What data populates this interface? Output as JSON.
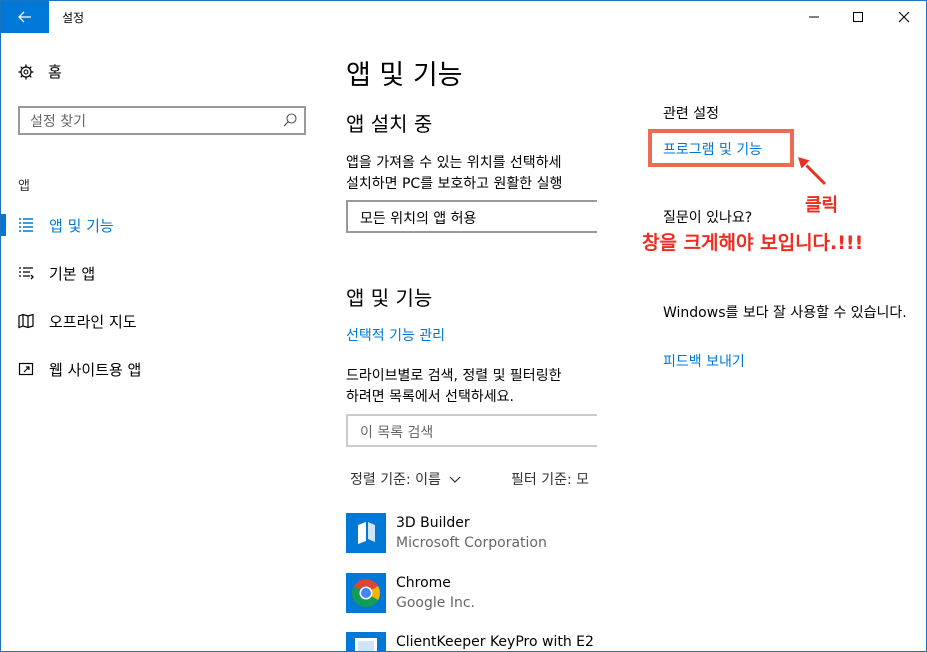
{
  "window": {
    "title": "설정"
  },
  "sidebar": {
    "home_label": "홈",
    "search_placeholder": "설정 찾기",
    "section_label": "앱",
    "items": [
      {
        "label": "앱 및 기능",
        "icon": "apps-features-icon",
        "active": true
      },
      {
        "label": "기본 앱",
        "icon": "default-apps-icon",
        "active": false
      },
      {
        "label": "오프라인 지도",
        "icon": "offline-maps-icon",
        "active": false
      },
      {
        "label": "웹 사이트용 앱",
        "icon": "apps-for-websites-icon",
        "active": false
      }
    ]
  },
  "main": {
    "page_title": "앱 및 기능",
    "install_heading": "앱 설치 중",
    "install_desc_line1": "앱을 가져올 수 있는 위치를 선택하세",
    "install_desc_line2": "설치하면 PC를 보호하고 원활한 실행",
    "install_dropdown_value": "모든 위치의 앱 허용",
    "apps_heading": "앱 및 기능",
    "optional_features_link": "선택적 기능 관리",
    "list_desc_line1": "드라이브별로 검색, 정렬 및 필터링한",
    "list_desc_line2": "하려면 목록에서 선택하세요.",
    "list_search_placeholder": "이 목록 검색",
    "sort_label": "정렬 기준: 이름",
    "filter_label": "필터 기준: 모",
    "apps": [
      {
        "name": "3D Builder",
        "publisher": "Microsoft Corporation",
        "icon": "3d-builder-icon"
      },
      {
        "name": "Chrome",
        "publisher": "Google Inc.",
        "icon": "chrome-icon"
      },
      {
        "name": "ClientKeeper KeyPro with E2",
        "publisher": "",
        "icon": "clientkeeper-icon"
      }
    ]
  },
  "related": {
    "title": "관련 설정",
    "programs_link": "프로그램 및 기능",
    "question_title": "질문이 있나요?",
    "feedback_text": "Windows를 보다 잘 사용할 수 있습니다.",
    "feedback_link": "피드백 보내기"
  },
  "annotations": {
    "click_label": "클릭",
    "resize_note": "창을 크게해야 보입니다.!!!"
  },
  "colors": {
    "accent": "#0078d7",
    "annotation": "#ee2c1f",
    "annotation_box": "#ec6c52"
  }
}
